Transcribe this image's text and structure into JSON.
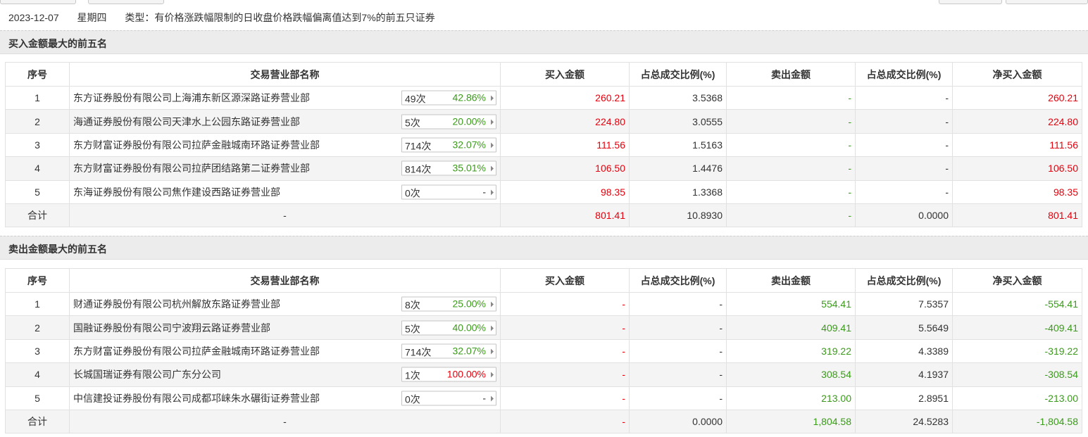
{
  "header": {
    "date": "2023-12-07",
    "weekday": "星期四",
    "type_text": "类型：有价格涨跌幅限制的日收盘价格跌幅偏离值达到7%的前五只证券"
  },
  "colors": {
    "positive": "#e4000c",
    "negative": "#3a9a19"
  },
  "columns": [
    "序号",
    "交易营业部名称",
    "买入金额",
    "占总成交比例(%)",
    "卖出金额",
    "占总成交比例(%)",
    "净买入金额"
  ],
  "buy_section": {
    "title": "买入金额最大的前五名",
    "rows": [
      {
        "idx": "1",
        "name": "东方证券股份有限公司上海浦东新区源深路证券营业部",
        "count": "49次",
        "pct": "42.86%",
        "buy": "260.21",
        "buy_ratio": "3.5368",
        "sell": "-",
        "sell_ratio": "-",
        "net": "260.21"
      },
      {
        "idx": "2",
        "name": "海通证券股份有限公司天津水上公园东路证券营业部",
        "count": "5次",
        "pct": "20.00%",
        "buy": "224.80",
        "buy_ratio": "3.0555",
        "sell": "-",
        "sell_ratio": "-",
        "net": "224.80"
      },
      {
        "idx": "3",
        "name": "东方财富证券股份有限公司拉萨金融城南环路证券营业部",
        "count": "714次",
        "pct": "32.07%",
        "buy": "111.56",
        "buy_ratio": "1.5163",
        "sell": "-",
        "sell_ratio": "-",
        "net": "111.56"
      },
      {
        "idx": "4",
        "name": "东方财富证券股份有限公司拉萨团结路第二证券营业部",
        "count": "814次",
        "pct": "35.01%",
        "buy": "106.50",
        "buy_ratio": "1.4476",
        "sell": "-",
        "sell_ratio": "-",
        "net": "106.50"
      },
      {
        "idx": "5",
        "name": "东海证券股份有限公司焦作建设西路证券营业部",
        "count": "0次",
        "pct": "-",
        "buy": "98.35",
        "buy_ratio": "1.3368",
        "sell": "-",
        "sell_ratio": "-",
        "net": "98.35"
      }
    ],
    "total": {
      "label": "合计",
      "name": "-",
      "buy": "801.41",
      "buy_ratio": "10.8930",
      "sell": "-",
      "sell_ratio": "0.0000",
      "net": "801.41"
    }
  },
  "sell_section": {
    "title": "卖出金额最大的前五名",
    "rows": [
      {
        "idx": "1",
        "name": "财通证券股份有限公司杭州解放东路证券营业部",
        "count": "8次",
        "pct": "25.00%",
        "buy": "-",
        "buy_ratio": "-",
        "sell": "554.41",
        "sell_ratio": "7.5357",
        "net": "-554.41"
      },
      {
        "idx": "2",
        "name": "国融证券股份有限公司宁波翔云路证券营业部",
        "count": "5次",
        "pct": "40.00%",
        "buy": "-",
        "buy_ratio": "-",
        "sell": "409.41",
        "sell_ratio": "5.5649",
        "net": "-409.41"
      },
      {
        "idx": "3",
        "name": "东方财富证券股份有限公司拉萨金融城南环路证券营业部",
        "count": "714次",
        "pct": "32.07%",
        "buy": "-",
        "buy_ratio": "-",
        "sell": "319.22",
        "sell_ratio": "4.3389",
        "net": "-319.22"
      },
      {
        "idx": "4",
        "name": "长城国瑞证券有限公司广东分公司",
        "count": "1次",
        "pct": "100.00%",
        "buy": "-",
        "buy_ratio": "-",
        "sell": "308.54",
        "sell_ratio": "4.1937",
        "net": "-308.54"
      },
      {
        "idx": "5",
        "name": "中信建投证券股份有限公司成都邛崃朱水碾街证券营业部",
        "count": "0次",
        "pct": "-",
        "buy": "-",
        "buy_ratio": "-",
        "sell": "213.00",
        "sell_ratio": "2.8951",
        "net": "-213.00"
      }
    ],
    "total": {
      "label": "合计",
      "name": "-",
      "buy": "-",
      "buy_ratio": "0.0000",
      "sell": "1,804.58",
      "sell_ratio": "24.5283",
      "net": "-1,804.58"
    }
  }
}
